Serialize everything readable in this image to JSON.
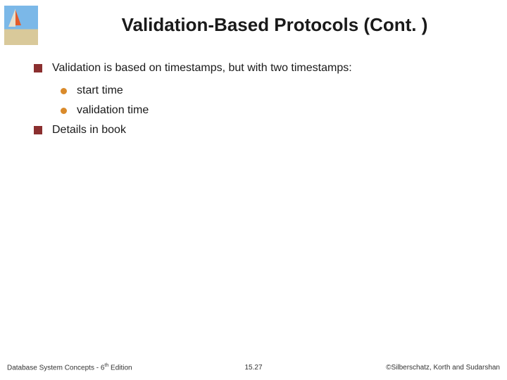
{
  "title": "Validation-Based Protocols (Cont. )",
  "bullets": [
    {
      "level": 1,
      "text": "Validation is based on timestamps, but with two timestamps:"
    },
    {
      "level": 2,
      "text": "start time"
    },
    {
      "level": 2,
      "text": "validation time"
    },
    {
      "level": 1,
      "text": "Details in book"
    }
  ],
  "footer": {
    "left_prefix": "Database System Concepts - 6",
    "left_sup": "th",
    "left_suffix": " Edition",
    "center": "15.27",
    "right": "©Silberschatz, Korth and Sudarshan"
  }
}
